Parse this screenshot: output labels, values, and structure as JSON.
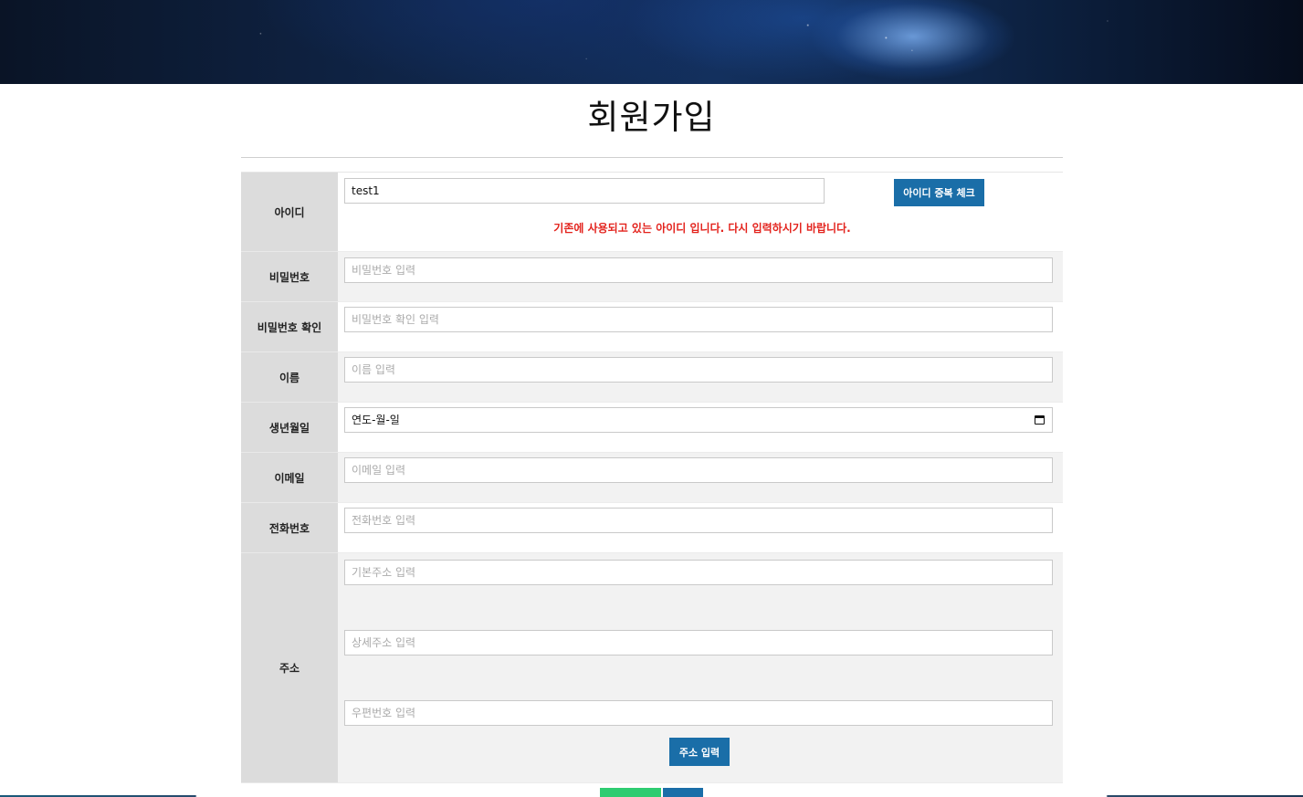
{
  "page": {
    "title": "회원가입"
  },
  "form": {
    "id": {
      "label": "아이디",
      "value": "test1",
      "check_button": "아이디 중복 체크",
      "error_message": "기존에 사용되고 있는 아이디 입니다. 다시 입력하시기 바랍니다."
    },
    "password": {
      "label": "비밀번호",
      "placeholder": "비밀번호 입력"
    },
    "password_confirm": {
      "label": "비밀번호 확인",
      "placeholder": "비밀번호 확인 입력"
    },
    "name": {
      "label": "이름",
      "placeholder": "이름 입력"
    },
    "birthdate": {
      "label": "생년월일",
      "value": "연도-월-일"
    },
    "email": {
      "label": "이메일",
      "placeholder": "이메일 입력"
    },
    "phone": {
      "label": "전화번호",
      "placeholder": "전화번호 입력"
    },
    "address": {
      "label": "주소",
      "base_placeholder": "기본주소 입력",
      "detail_placeholder": "상세주소 입력",
      "zip_placeholder": "우편번호 입력",
      "button": "주소 입력"
    }
  },
  "colors": {
    "accent": "#1a6ea8",
    "error": "#e3231d",
    "submit_green": "#2ecc71"
  },
  "icons": {
    "date_picker": "calendar-icon"
  }
}
